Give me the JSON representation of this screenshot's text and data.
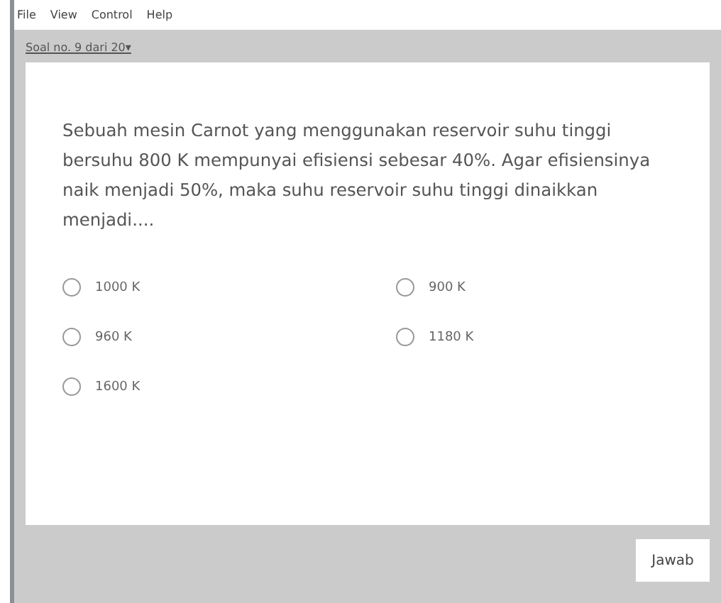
{
  "menu_bar": {
    "items": [
      "File",
      "View",
      "Control",
      "Help"
    ]
  },
  "question_selector": {
    "label": "Soal no. 9 dari 20",
    "caret": "▾"
  },
  "question": {
    "text": "Sebuah mesin Carnot yang menggunakan reservoir suhu tinggi bersuhu 800 K mempunyai efisiensi sebesar 40%. Agar efisiensinya naik menjadi 50%, maka suhu reservoir suhu tinggi dinaikkan menjadi....",
    "options": [
      {
        "label": "1000 K",
        "selected": false
      },
      {
        "label": "900 K",
        "selected": false
      },
      {
        "label": "960 K",
        "selected": false
      },
      {
        "label": "1180 K",
        "selected": false
      },
      {
        "label": "1600 K",
        "selected": false
      }
    ]
  },
  "submit_button": {
    "label": "Jawab"
  }
}
